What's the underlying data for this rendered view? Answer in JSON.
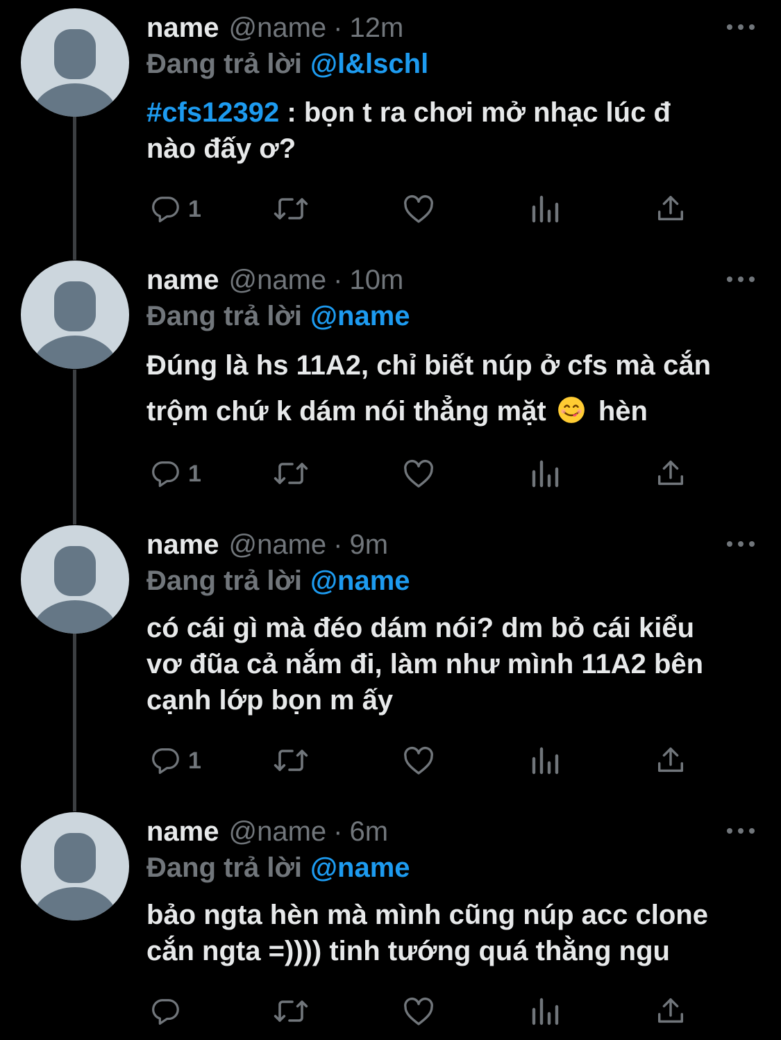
{
  "colors": {
    "background": "#000000",
    "text_primary": "#e7e9ea",
    "text_secondary": "#71767b",
    "accent": "#1d9bf0",
    "avatar_bg": "#ccd6dd",
    "avatar_fg": "#657786"
  },
  "icons": [
    "reply-icon",
    "retweet-icon",
    "like-icon",
    "analytics-icon",
    "share-icon",
    "more-icon",
    "face-savoring-food-emoji"
  ],
  "tweets": [
    {
      "display_name": "name",
      "handle": "@name",
      "dot": "·",
      "time": "12m",
      "reply_prefix": "Đang trả lời",
      "reply_to": "@l&lschl",
      "hashtag": "#cfs12392",
      "text_line_1": " : bọn t ra chơi mở nhạc lúc đ",
      "text_line_2": "nào đấy ơ?",
      "reply_count": "1"
    },
    {
      "display_name": "name",
      "handle": "@name",
      "dot": "·",
      "time": "10m",
      "reply_prefix": "Đang trả lời",
      "reply_to": "@name",
      "text_line_1": "Đúng là hs 11A2, chỉ biết núp ở cfs mà cắn",
      "text_line_2": "trộm chứ k dám nói thẳng mặt",
      "text_after_emoji": "hèn",
      "reply_count": "1"
    },
    {
      "display_name": "name",
      "handle": "@name",
      "dot": "·",
      "time": "9m",
      "reply_prefix": "Đang trả lời",
      "reply_to": "@name",
      "text_line_1": "có cái gì mà đéo dám nói? dm bỏ cái kiểu",
      "text_line_2": "vơ đũa cả nắm đi, làm như mình 11A2 bên",
      "text_line_3": "cạnh lớp bọn m ấy",
      "reply_count": "1"
    },
    {
      "display_name": "name",
      "handle": "@name",
      "dot": "·",
      "time": "6m",
      "reply_prefix": "Đang trả lời",
      "reply_to": "@name",
      "text_line_1": "bảo ngta hèn mà mình cũng núp acc clone",
      "text_line_2": "cắn ngta =)))) tinh tướng quá thằng ngu",
      "reply_count": ""
    }
  ]
}
